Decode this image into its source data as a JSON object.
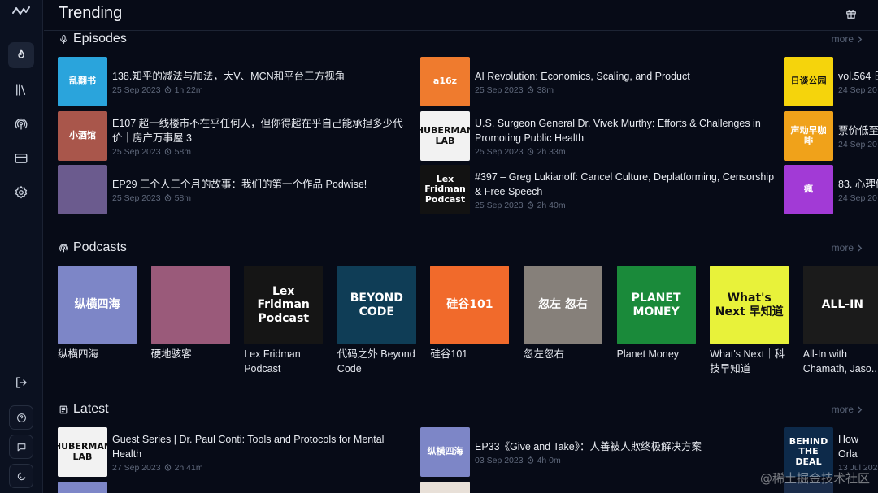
{
  "app": {
    "logo_icon": "podwise-logo",
    "title": "Trending"
  },
  "sidebar": {
    "items": [
      {
        "icon": "flame-icon",
        "active": true
      },
      {
        "icon": "library-icon"
      },
      {
        "icon": "podcast-icon"
      },
      {
        "icon": "card-icon"
      },
      {
        "icon": "gear-icon"
      }
    ],
    "bottom": [
      {
        "icon": "logout-icon"
      },
      {
        "icon": "help-icon"
      },
      {
        "icon": "chat-icon"
      },
      {
        "icon": "theme-icon"
      }
    ]
  },
  "sections": {
    "episodes": {
      "title": "Episodes",
      "more": "more"
    },
    "podcasts": {
      "title": "Podcasts",
      "more": "more"
    },
    "latest": {
      "title": "Latest",
      "more": "more"
    }
  },
  "episodes": [
    {
      "title": "138.知乎的减法与加法，大V、MCN和平台三方视角",
      "date": "25 Sep 2023",
      "duration": "1h 22m",
      "cover_text": "乱翻书",
      "cover_bg": "#2aa4dc"
    },
    {
      "title": "E107 超一线楼市不在乎任何人，但你得超在乎自己能承担多少代价｜房产万事屋 3",
      "date": "25 Sep 2023",
      "duration": "58m",
      "cover_text": "小酒馆",
      "cover_bg": "#a9564b"
    },
    {
      "title": "EP29 三个人三个月的故事：我们的第一个作品 Podwise!",
      "date": "25 Sep 2023",
      "duration": "58m",
      "cover_text": "",
      "cover_bg": "#6b5b8e"
    },
    {
      "title": "AI Revolution: Economics, Scaling, and Product",
      "date": "25 Sep 2023",
      "duration": "38m",
      "cover_text": "a16z",
      "cover_bg": "#ef7b2e"
    },
    {
      "title": "U.S. Surgeon General Dr. Vivek Murthy: Efforts & Challenges in Promoting Public Health",
      "date": "25 Sep 2023",
      "duration": "2h 33m",
      "cover_text": "HUBERMAN LAB",
      "cover_bg": "#f2f2f2"
    },
    {
      "title": "#397 – Greg Lukianoff: Cancel Culture, Deplatforming, Censorship & Free Speech",
      "date": "25 Sep 2023",
      "duration": "2h 40m",
      "cover_text": "Lex Fridman Podcast",
      "cover_bg": "#121212"
    },
    {
      "title": "vol.564 日",
      "date": "24 Sep 20",
      "duration": "",
      "cover_text": "日谈公园",
      "cover_bg": "#f5d40c"
    },
    {
      "title": "票价低至",
      "date": "24 Sep 20",
      "duration": "",
      "cover_text": "声动早咖啡",
      "cover_bg": "#f0a21a"
    },
    {
      "title": "83. 心理健",
      "date": "24 Sep 20",
      "duration": "",
      "cover_text": "瘋",
      "cover_bg": "#a23ad6"
    }
  ],
  "podcasts": [
    {
      "name": "纵横四海",
      "cover_text": "纵横四海",
      "cover_bg": "#7d86c7"
    },
    {
      "name": "硬地骇客",
      "cover_text": "",
      "cover_bg": "#9a5a7a"
    },
    {
      "name": "Lex Fridman Podcast",
      "cover_text": "Lex Fridman Podcast",
      "cover_bg": "#151515"
    },
    {
      "name": "代码之外 Beyond Code",
      "cover_text": "BEYOND CODE",
      "cover_bg": "#0f3d56"
    },
    {
      "name": "硅谷101",
      "cover_text": "硅谷101",
      "cover_bg": "#f16a2b"
    },
    {
      "name": "忽左忽右",
      "cover_text": "忽左 忽右",
      "cover_bg": "#86807a"
    },
    {
      "name": "Planet Money",
      "cover_text": "PLANET MONEY",
      "cover_bg": "#1a8a3a"
    },
    {
      "name": "What's Next｜科技早知道",
      "cover_text": "What's Next 早知道",
      "cover_bg": "#e8f23a"
    },
    {
      "name": "All-In with Chamath, Jaso...",
      "cover_text": "ALL-IN",
      "cover_bg": "#1b1b1b"
    }
  ],
  "latest": [
    {
      "title": "Guest Series | Dr. Paul Conti: Tools and Protocols for Mental Health",
      "date": "27 Sep 2023",
      "duration": "2h 41m",
      "cover_text": "HUBERMAN LAB",
      "cover_bg": "#f2f2f2"
    },
    {
      "title": "EP33《Give and Take》：人善被人欺终极解决方案",
      "date": "03 Sep 2023",
      "duration": "4h 0m",
      "cover_text": "纵横四海",
      "cover_bg": "#7d86c7"
    },
    {
      "title": "How Orla Buyout F",
      "date": "13 Jul 202",
      "duration": "",
      "cover_text": "BEHIND THE DEAL",
      "cover_bg": "#0d2a4a"
    }
  ],
  "watermark": "@稀土掘金技术社区"
}
